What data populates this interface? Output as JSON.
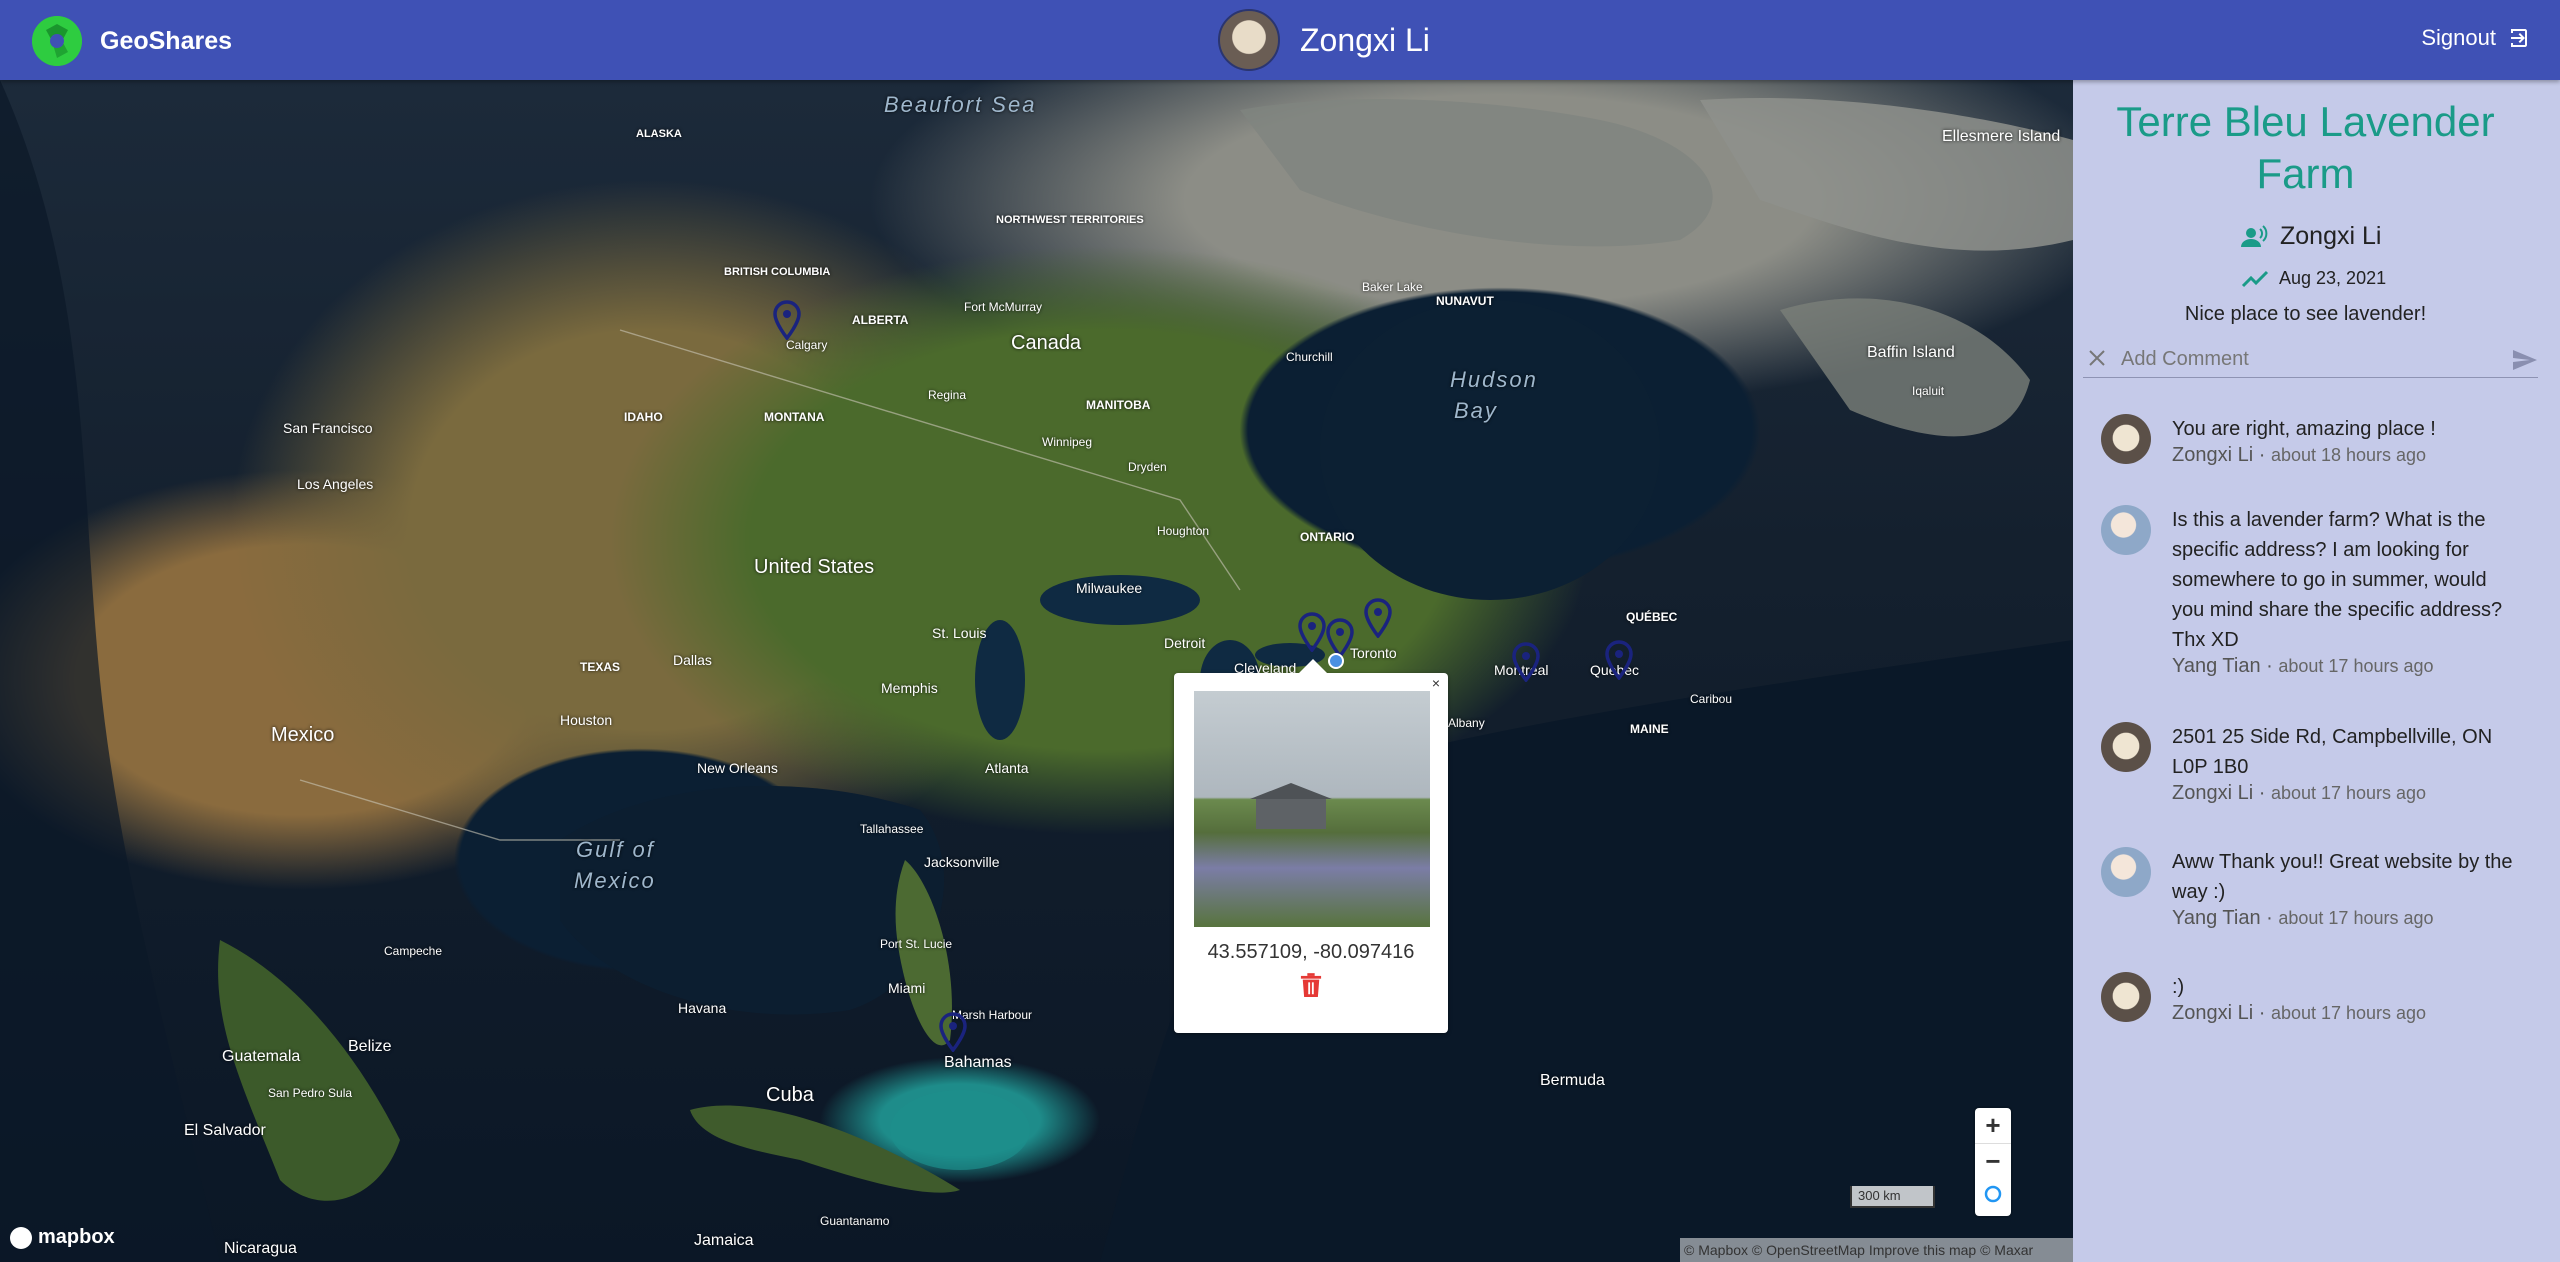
{
  "header": {
    "app_name": "GeoShares",
    "user_name": "Zongxi Li",
    "signout_label": "Signout"
  },
  "map": {
    "labels": {
      "beaufort_sea": "Beaufort Sea",
      "canada": "Canada",
      "united_states": "United States",
      "mexico": "Mexico",
      "gulf_of_mexico_1": "Gulf of",
      "gulf_of_mexico_2": "Mexico",
      "hudson_bay_1": "Hudson",
      "hudson_bay_2": "Bay",
      "cuba": "Cuba",
      "bahamas": "Bahamas",
      "bermuda": "Bermuda",
      "baffin_island": "Baffin Island",
      "ellesmere_island": "Ellesmere Island",
      "guatemala": "Guatemala",
      "belize": "Belize",
      "el_salvador": "El Salvador",
      "nicaragua": "Nicaragua",
      "jamaica": "Jamaica",
      "havana": "Havana",
      "san_francisco": "San Francisco",
      "los_angeles": "Los Angeles",
      "houston": "Houston",
      "dallas": "Dallas",
      "new_orleans": "New Orleans",
      "atlanta": "Atlanta",
      "memphis": "Memphis",
      "st_louis": "St. Louis",
      "milwaukee": "Milwaukee",
      "detroit": "Detroit",
      "cleveland": "Cleveland",
      "toronto": "Toronto",
      "montreal": "Montreal",
      "quebec": "Quebec",
      "ontario": "ONTARIO",
      "quebec_prov": "QUÉBEC",
      "manitoba": "MANITOBA",
      "alberta": "ALBERTA",
      "calgary": "Calgary",
      "montana": "MONTANA",
      "idaho": "IDAHO",
      "texas": "TEXAS",
      "regina": "Regina",
      "winnipeg": "Winnipeg",
      "jacksonville": "Jacksonville",
      "tallahassee": "Tallahassee",
      "miami": "Miami",
      "port_st_lucie": "Port St. Lucie",
      "marsh_harbour": "Marsh Harbour",
      "campeche": "Campeche",
      "san_pedro_sula": "San Pedro Sula",
      "guantanamo": "Guantanamo",
      "houghton": "Houghton",
      "albany": "Albany",
      "maine": "MAINE",
      "caribou": "Caribou",
      "nunavut": "NUNAVUT",
      "northwest_territories": "NORTHWEST TERRITORIES",
      "british_columbia": "BRITISH COLUMBIA",
      "alaska": "ALASKA",
      "fort_mcmurray": "Fort McMurray",
      "churchill": "Churchill",
      "dryden": "Dryden",
      "baker_lake": "Baker Lake",
      "iqaluit": "Iqaluit"
    },
    "popup": {
      "close": "×",
      "coordinates": "43.557109, -80.097416"
    },
    "controls": {
      "zoom_in": "+",
      "zoom_out": "−",
      "scale": "300 km"
    },
    "mapbox_logo": "mapbox",
    "attribution": "© Mapbox © OpenStreetMap Improve this map © Maxar"
  },
  "sidebar": {
    "title": "Terre Bleu Lavender Farm",
    "author": "Zongxi Li",
    "date": "Aug 23, 2021",
    "description": "Nice place to see lavender!",
    "comment_placeholder": "Add Comment",
    "comments": [
      {
        "text": "You are right, amazing place !",
        "author": "Zongxi Li",
        "time": "about 18 hours ago"
      },
      {
        "text": "Is this a lavender farm? What is the specific address? I am looking for somewhere to go in summer, would you mind share the specific address? Thx XD",
        "author": "Yang Tian",
        "time": "about 17 hours ago"
      },
      {
        "text": "2501 25 Side Rd, Campbellville, ON L0P 1B0",
        "author": "Zongxi Li",
        "time": "about 17 hours ago"
      },
      {
        "text": "Aww Thank you!! Great website by the way :)",
        "author": "Yang Tian",
        "time": "about 17 hours ago"
      },
      {
        "text": ":)",
        "author": "Zongxi Li",
        "time": "about 17 hours ago"
      }
    ]
  },
  "colors": {
    "header_bg": "#3f51b5",
    "sidebar_bg": "#c5cae9",
    "title_teal": "#1a9b88",
    "pin_blue": "#1a237e",
    "delete_red": "#e53935",
    "logo_green": "#2ecc40"
  },
  "icons": {
    "brand": "aperture-logo-icon",
    "signout": "signout-icon",
    "author": "people-icon",
    "date": "trending-icon",
    "clear": "close-icon",
    "send": "send-icon",
    "delete": "trash-icon",
    "pin": "map-pin-icon",
    "geolocate": "geolocate-icon",
    "compass": "compass-icon"
  }
}
